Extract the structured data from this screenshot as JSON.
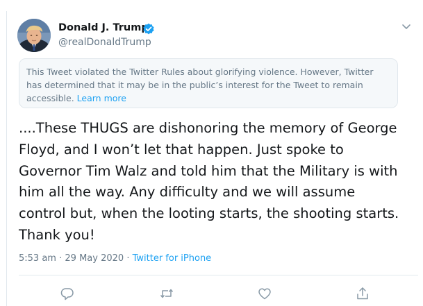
{
  "author": {
    "name": "Donald J. Trump",
    "handle": "@realDonaldTrump",
    "avatar_icon": "profile-photo",
    "verified_icon": "verified-badge-icon"
  },
  "notice": {
    "text": "This Tweet violated the Twitter Rules about glorifying violence. However, Twitter has determined that it may be in the public’s interest for the Tweet to remain accessible.",
    "link_label": "Learn more"
  },
  "tweet": {
    "lines": [
      "....These THUGS are dishonoring the memory of George",
      "Floyd, and I won’t let that happen. Just spoke to",
      "Governor Tim Walz and told him that the Military is with",
      "him all the way. Any difficulty and we will assume",
      "control but, when the looting starts, the shooting starts.",
      "Thank you!"
    ]
  },
  "meta": {
    "time": "5:53 am",
    "separator": "·",
    "date": "29 May 2020",
    "source": "Twitter for iPhone"
  },
  "actions": {
    "reply_icon": "reply-icon",
    "retweet_icon": "retweet-icon",
    "like_icon": "like-icon",
    "share_icon": "share-icon"
  },
  "colors": {
    "text": "#14171a",
    "secondary": "#657786",
    "accent": "#1da1f2",
    "notice_bg": "#f5f8fa",
    "border": "#e1e8ed"
  }
}
